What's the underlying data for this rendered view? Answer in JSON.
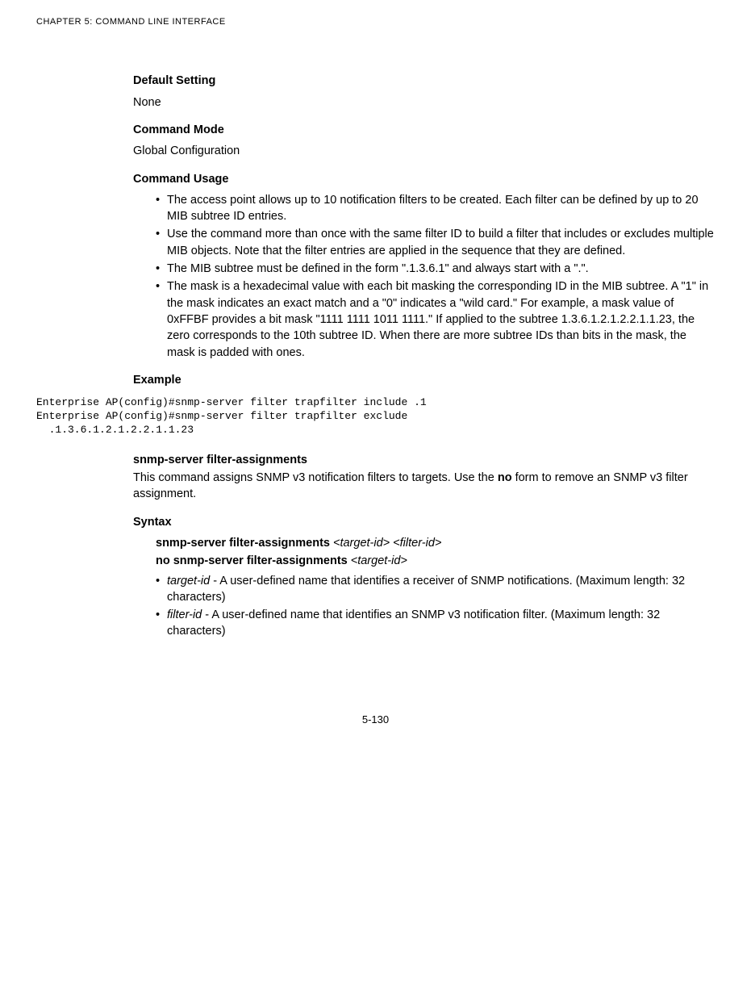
{
  "header": {
    "chapter": "CHAPTER 5: COMMAND LINE INTERFACE"
  },
  "content": {
    "defaultSetting": {
      "heading": "Default Setting",
      "value": "None"
    },
    "commandMode": {
      "heading": "Command Mode",
      "value": "Global Configuration"
    },
    "commandUsage": {
      "heading": "Command Usage",
      "bullets": [
        "The access point allows up to 10 notification filters to be created. Each filter can be defined by up to 20 MIB subtree ID entries.",
        "Use the command more than once with the same filter ID to build a filter that includes or excludes multiple MIB objects. Note that the filter entries are applied in the sequence that they are defined.",
        "The MIB subtree must be defined in the form \".1.3.6.1\" and always start with a \".\".",
        "The mask is a hexadecimal value with each bit masking the corresponding ID in the MIB subtree. A \"1\" in the mask indicates an exact match and a \"0\" indicates a \"wild card.\" For example, a mask value of 0xFFBF provides a bit mask \"1111 1111 1011 1111.\" If applied to the subtree 1.3.6.1.2.1.2.2.1.1.23, the zero corresponds to the 10th subtree ID. When there are more subtree IDs than bits in the mask, the mask is padded with ones."
      ]
    },
    "example": {
      "heading": "Example",
      "code": "Enterprise AP(config)#snmp-server filter trapfilter include .1\nEnterprise AP(config)#snmp-server filter trapfilter exclude\n  .1.3.6.1.2.1.2.2.1.1.23"
    },
    "filterAssignments": {
      "heading": "snmp-server filter-assignments",
      "descPart1": "This command assigns SNMP v3 notification filters to targets. Use the ",
      "descBold": "no",
      "descPart2": " form to remove an SNMP v3 filter assignment."
    },
    "syntax": {
      "heading": "Syntax",
      "line1bold": "snmp-server filter-assignments",
      "line1arg1": "<target-id>",
      "line1arg2": "<filter-id>",
      "line2bold": "no snmp-server filter-assignments",
      "line2arg1": "<target-id>",
      "bullets": [
        {
          "term": "target-id",
          "desc": " - A user-defined name that identifies a receiver of SNMP notifications. (Maximum length: 32 characters)"
        },
        {
          "term": "filter-id",
          "desc": " - A user-defined name that identifies an SNMP v3 notification filter. (Maximum length: 32 characters)"
        }
      ]
    }
  },
  "pageNumber": "5-130"
}
